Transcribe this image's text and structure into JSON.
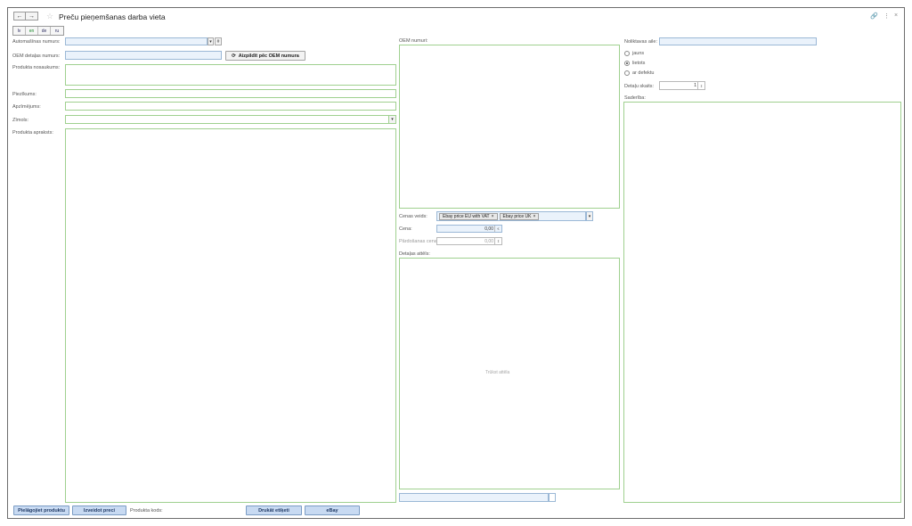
{
  "header": {
    "back_label": "←",
    "forward_label": "→",
    "star_icon": "☆",
    "title": "Preču pieņemšanas darba vieta",
    "link_icon": "🔗",
    "more_icon": "⋮",
    "close_icon": "×"
  },
  "languages": [
    {
      "code": "lv",
      "active": false
    },
    {
      "code": "en",
      "active": true
    },
    {
      "code": "de",
      "active": false
    },
    {
      "code": "ru",
      "active": false
    }
  ],
  "left": {
    "car_number_label": "Automašīnas numurs:",
    "car_number_value": "",
    "dropdown_icon": "▾",
    "car_extra_icon": "#",
    "oem_part_label": "OEM detaļas numurs:",
    "oem_part_value": "",
    "fill_by_oem_label": "Aizpildīt pēc OEM numura",
    "product_name_label": "Produkta nosaukums:",
    "notes_label": "Piezīkums:",
    "description_short_label": "Apzīmējums:",
    "brand_label": "Zīmols:",
    "product_desc_label": "Produkta apraksts:"
  },
  "middle": {
    "oem_numbers_label": "OEM numuri:",
    "price_types_label": "Cenas veids:",
    "price_tags": [
      "Ebay price EU with VAT",
      "Ebay price UK"
    ],
    "tag_remove_icon": "×",
    "price_label": "Cena:",
    "price_value": "0,00",
    "currency_icon": "€",
    "sale_price_label": "Pārdošanas cena:",
    "sale_price_value": "0,00",
    "part_photo_label": "Detaļas attēls:",
    "no_photo_text": "Trūkst attēla"
  },
  "right": {
    "warehouse_label": "Noliktavas aile:",
    "warehouse_value": "",
    "conditions": [
      {
        "label": "jauns",
        "selected": false
      },
      {
        "label": "lietots",
        "selected": true
      },
      {
        "label": "ar defektu",
        "selected": false
      }
    ],
    "parts_count_label": "Detaļu skaits:",
    "parts_count_value": "1",
    "compatibility_label": "Saderība:"
  },
  "footer": {
    "save_product_label": "Pielāgojiet produktu",
    "create_price_label": "Izveidot preci",
    "product_code_label": "Produkta kods:",
    "print_label_label": "Drukāt etiķeti",
    "ebay_label": "eBay"
  },
  "colors": {
    "field_border": "#9fd08f",
    "button_fill": "#c8daf2",
    "button_text": "#203a66"
  }
}
